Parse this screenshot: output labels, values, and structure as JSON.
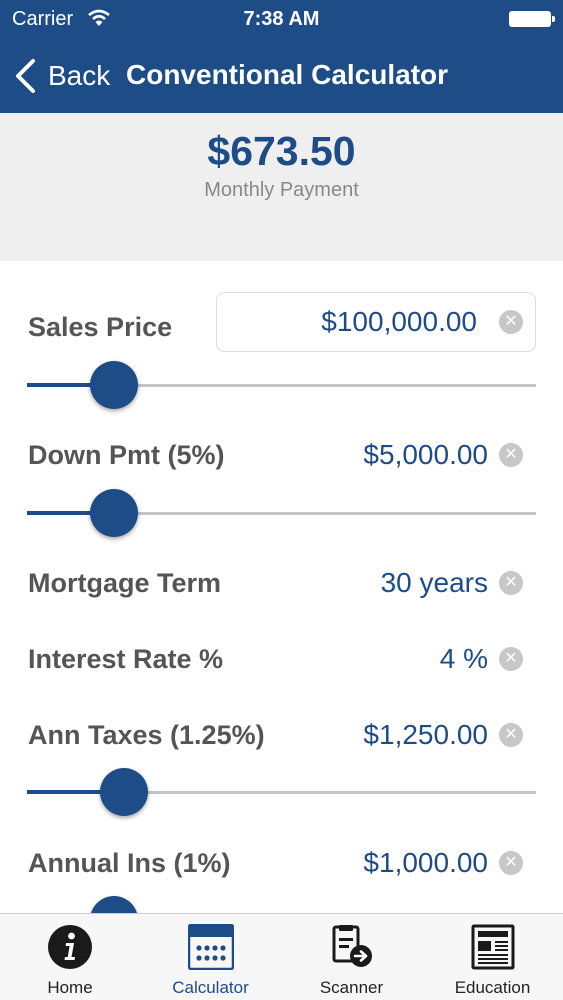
{
  "status_bar": {
    "carrier": "Carrier",
    "time": "7:38 AM"
  },
  "nav": {
    "back_label": "Back",
    "title": "Conventional Calculator"
  },
  "summary": {
    "amount": "$673.50",
    "caption": "Monthly Payment"
  },
  "fields": {
    "sales_price": {
      "label": "Sales Price",
      "value": "$100,000.00",
      "slider_fraction": 0.17
    },
    "down_payment": {
      "label": "Down Pmt (5%)",
      "value": "$5,000.00",
      "slider_fraction": 0.17
    },
    "mortgage_term": {
      "label": "Mortgage Term",
      "value": "30 years"
    },
    "interest_rate": {
      "label": "Interest Rate %",
      "value": "4 %"
    },
    "ann_taxes": {
      "label": "Ann Taxes (1.25%)",
      "value": "$1,250.00",
      "slider_fraction": 0.19
    },
    "annual_ins": {
      "label": "Annual Ins (1%)",
      "value": "$1,000.00",
      "slider_fraction": 0.17
    }
  },
  "tabs": [
    {
      "label": "Home",
      "icon": "info-icon",
      "active": false
    },
    {
      "label": "Calculator",
      "icon": "calculator-icon",
      "active": true
    },
    {
      "label": "Scanner",
      "icon": "scanner-icon",
      "active": false
    },
    {
      "label": "Education",
      "icon": "newspaper-icon",
      "active": false
    }
  ],
  "colors": {
    "brand": "#1d4c87",
    "label": "#555555",
    "clear": "#c7c7c7",
    "summary_bg": "#efefef"
  }
}
